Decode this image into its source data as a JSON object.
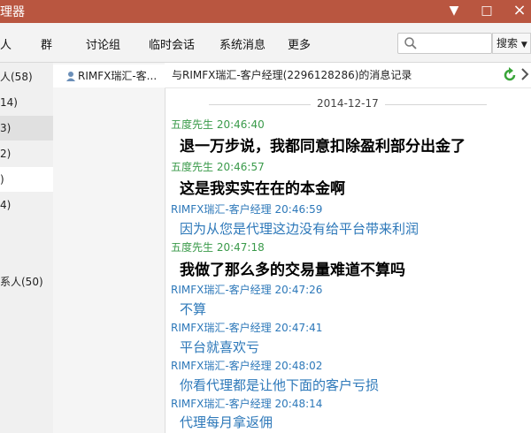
{
  "window": {
    "title": "理器",
    "min_label": "▼",
    "close_label": "×"
  },
  "menu": {
    "items": [
      "人",
      "群",
      "讨论组",
      "临时会话",
      "系统消息",
      "更多"
    ],
    "search_button": "搜索"
  },
  "groups": [
    {
      "label": "人(58)"
    },
    {
      "label": "14)"
    },
    {
      "label": "3)"
    },
    {
      "label": "2)"
    },
    {
      "label": ")"
    },
    {
      "label": "4)"
    },
    {
      "label": "系人(50)"
    }
  ],
  "conversation": {
    "label": "RIMFX瑞汇-客..."
  },
  "chat": {
    "header_title": "与RIMFX瑞汇-客户经理(2296128286)的消息记录",
    "date": "2014-12-17",
    "messages": [
      {
        "sender": "五度先生",
        "time": "20:46:40",
        "text": "退一万步说，我都同意扣除盈利部分出金了"
      },
      {
        "sender": "五度先生",
        "time": "20:46:57",
        "text": "这是我实实在在的本金啊"
      },
      {
        "sender": "RIMFX瑞汇-客户经理",
        "time": "20:46:59",
        "text": "因为从您是代理这边没有给平台带来利润"
      },
      {
        "sender": "五度先生",
        "time": "20:47:18",
        "text": "我做了那么多的交易量难道不算吗"
      },
      {
        "sender": "RIMFX瑞汇-客户经理",
        "time": "20:47:26",
        "text": "不算"
      },
      {
        "sender": "RIMFX瑞汇-客户经理",
        "time": "20:47:41",
        "text": "平台就喜欢亏"
      },
      {
        "sender": "RIMFX瑞汇-客户经理",
        "time": "20:48:02",
        "text": "你看代理都是让他下面的客户亏损"
      },
      {
        "sender": "RIMFX瑞汇-客户经理",
        "time": "20:48:14",
        "text": "代理每月拿返佣"
      }
    ]
  },
  "colors": {
    "titlebar": "#b95640",
    "self_name": "#3a9a4a",
    "other_name": "#2d78b9"
  }
}
